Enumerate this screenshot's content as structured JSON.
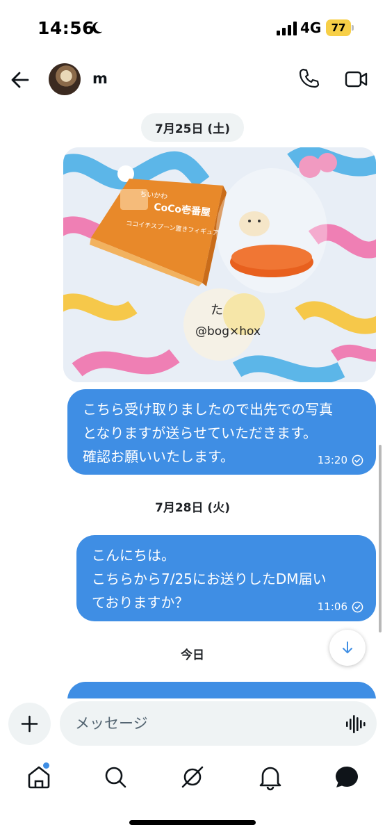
{
  "status": {
    "time": "14:56",
    "network": "4G",
    "battery": "77"
  },
  "header": {
    "contact_name": "m"
  },
  "messages": {
    "date_1": "7月25日 (土)",
    "photo_box_brand": "CoCo壱番屋",
    "photo_box_title": "ココイチスプーン置きフィギュア",
    "photo_box_subtitle": "ちいかわ",
    "photo_card_text": "@bog×hox",
    "bubble_1": "こちら受け取りましたので出先での写真\nとなりますが送らせていただきます。\n確認お願いいたします。",
    "bubble_1_time": "13:20",
    "date_2": "7月28日 (火)",
    "bubble_2": "こんにちは。\nこちらから7/25にお送りしたDM届い\nておりますか？",
    "bubble_2_time": "11:06",
    "date_3": "今日"
  },
  "composer": {
    "placeholder": "メッセージ"
  },
  "tabs": [
    "home-icon",
    "search-icon",
    "grok-icon",
    "bell-icon",
    "messages-icon"
  ],
  "colors": {
    "bubble": "#3f8ee4",
    "chip": "#eff3f4",
    "battery": "#f7cf47"
  }
}
